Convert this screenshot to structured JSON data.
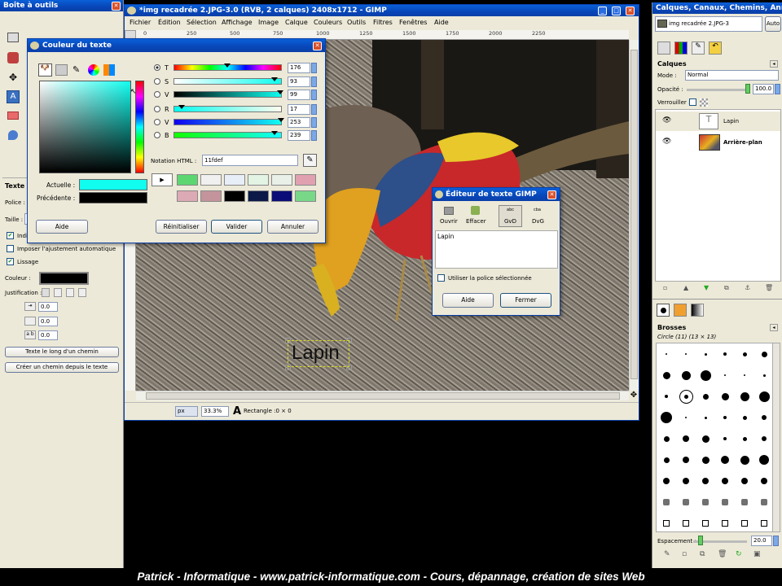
{
  "toolbox": {
    "title": "Boîte à outils",
    "section": "Texte",
    "police_label": "Police :",
    "taille_label": "Taille :",
    "ind_label": "Indi",
    "imposer_label": "Imposer l'ajustement automatique",
    "lissage_label": "Lissage",
    "couleur_label": "Couleur :",
    "justif_label": "Justification :",
    "indent_val": "0.0",
    "line_val": "0.0",
    "letter_val": "0.0",
    "btn_path": "Texte le long d'un chemin",
    "btn_create_path": "Créer un chemin depuis le texte"
  },
  "main": {
    "title": "*img recadrée 2.JPG-3.0 (RVB, 2 calques) 2408x1712 - GIMP",
    "menu": [
      "Fichier",
      "Édition",
      "Sélection",
      "Affichage",
      "Image",
      "Calque",
      "Couleurs",
      "Outils",
      "Filtres",
      "Fenêtres",
      "Aide"
    ],
    "ruler": [
      "0",
      "250",
      "500",
      "750",
      "1000",
      "1250",
      "1500",
      "1750",
      "2000",
      "2250"
    ],
    "unit": "px",
    "zoom": "33.3%",
    "status": "Rectangle :0 × 0",
    "canvas_text": "Lapin"
  },
  "color": {
    "title": "Couleur du texte",
    "T": "176",
    "S": "93",
    "V": "99",
    "R": "17",
    "V2": "253",
    "B": "239",
    "html_label": "Notation HTML :",
    "html": "11fdef",
    "actuelle": "Actuelle :",
    "precedente": "Précédente :",
    "current_color": "#11fdef",
    "previous_color": "#000000",
    "history": [
      "#5cd670",
      "#f0f0f0",
      "#e8eef8",
      "#e4f4e4",
      "#e8f0e8",
      "#e0a0b0",
      "#dcaab4",
      "#c4949c",
      "#000000",
      "#0c1848",
      "#0c0c78",
      "#78d888"
    ],
    "btn_aide": "Aide",
    "btn_reinit": "Réinitialiser",
    "btn_valider": "Valider",
    "btn_annuler": "Annuler"
  },
  "texted": {
    "title": "Éditeur de texte GIMP",
    "ouvrir": "Ouvrir",
    "effacer": "Effacer",
    "gvd": "GvD",
    "dvg": "DvG",
    "text": "Lapin",
    "use_font": "Utiliser la police sélectionnée",
    "aide": "Aide",
    "fermer": "Fermer"
  },
  "layers": {
    "title": "Calques, Canaux, Chemins, Annul...",
    "image": "img recadrée 2.JPG-3",
    "auto": "Auto",
    "heading": "Calques",
    "mode_label": "Mode :",
    "mode": "Normal",
    "opacity_label": "Opacité :",
    "opacity": "100.0",
    "lock_label": "Verrouiller :",
    "items": [
      "Lapin",
      "Arrière-plan"
    ]
  },
  "brushes": {
    "heading": "Brosses",
    "selected": "Circle (11) (13 × 13)",
    "spacing_label": "Espacement :",
    "spacing": "20.0"
  },
  "footer": {
    "text": "Patrick - Informatique - www.patrick-informatique.com - Cours, dépannage, création de sites Web"
  }
}
